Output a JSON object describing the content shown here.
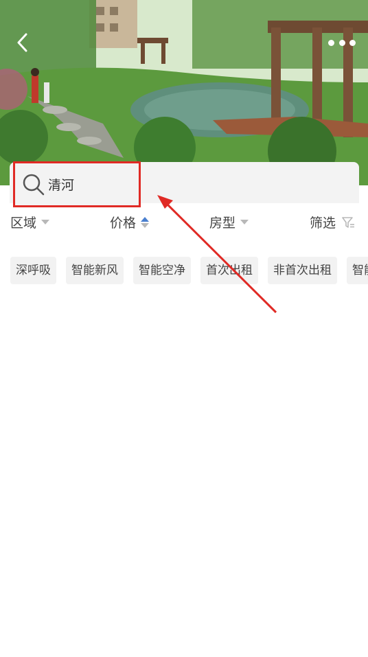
{
  "search": {
    "value": "清河",
    "icon": "search-icon"
  },
  "filters": [
    {
      "label": "区域",
      "indicator": "dropdown"
    },
    {
      "label": "价格",
      "indicator": "sort-asc"
    },
    {
      "label": "房型",
      "indicator": "dropdown"
    },
    {
      "label": "筛选",
      "indicator": "filter-icon"
    }
  ],
  "tags": [
    "深呼吸",
    "智能新风",
    "智能空净",
    "首次出租",
    "非首次出租",
    "智能"
  ],
  "colors": {
    "highlight": "#e02a25",
    "sort_active": "#4a7fcf",
    "tag_bg": "#f2f2f2"
  }
}
